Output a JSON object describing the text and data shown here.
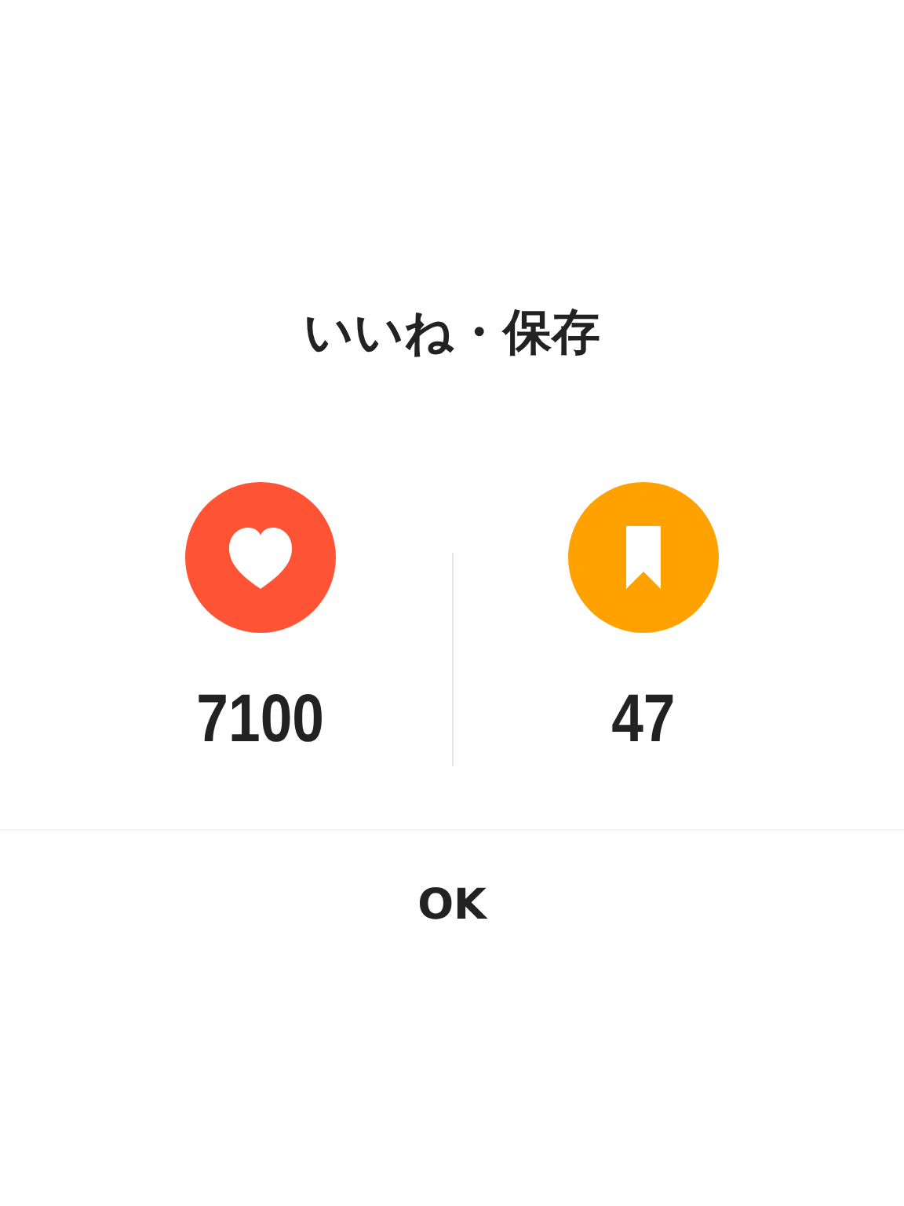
{
  "dialog": {
    "title": "いいね・保存",
    "stats": [
      {
        "kind": "likes",
        "color": "#fe5435",
        "count": "7100"
      },
      {
        "kind": "saves",
        "color": "#ffa200",
        "count": "47"
      }
    ],
    "buttons": [
      "OK"
    ]
  }
}
